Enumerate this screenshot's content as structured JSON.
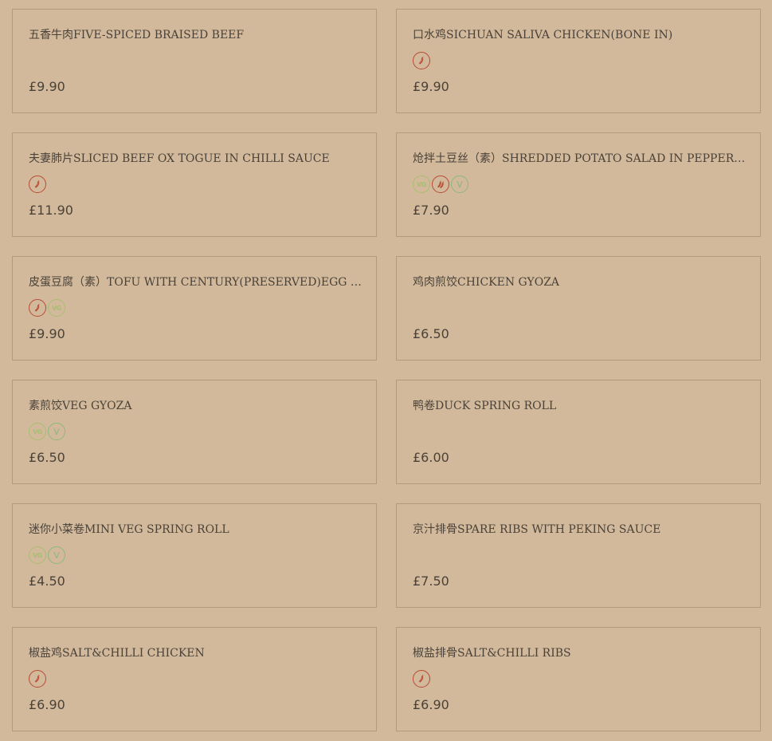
{
  "colors": {
    "background": "#d2b99b",
    "border": "#b39a7e",
    "text": "#4a4239",
    "chilli": "#b84a33",
    "vegan": "#a8be70",
    "vegetarian": "#8cb87a"
  },
  "badge_labels": {
    "chilli": "",
    "vg": "VG",
    "v": "V"
  },
  "items": [
    {
      "name": "五香牛肉FIVE-SPICED BRAISED BEEF",
      "price": "£9.90",
      "badges": []
    },
    {
      "name": "口水鸡SICHUAN SALIVA CHICKEN(BONE IN)",
      "price": "£9.90",
      "badges": [
        "chilli-icon"
      ]
    },
    {
      "name": "夫妻肺片SLICED BEEF OX TOGUE IN CHILLI SAUCE",
      "price": "£11.90",
      "badges": [
        "chilli-icon"
      ]
    },
    {
      "name": "炝拌土豆丝（素）SHREDDED POTATO SALAD IN PEPPERCOR...",
      "price": "£7.90",
      "badges": [
        "vegan-icon",
        "double-chilli-icon",
        "vegetarian-icon"
      ]
    },
    {
      "name": "皮蛋豆腐（素）TOFU WITH CENTURY(PRESERVED)EGG SALAD",
      "price": "£9.90",
      "badges": [
        "chilli-icon",
        "vegan-icon"
      ]
    },
    {
      "name": "鸡肉煎饺CHICKEN GYOZA",
      "price": "£6.50",
      "badges": []
    },
    {
      "name": "素煎饺VEG GYOZA",
      "price": "£6.50",
      "badges": [
        "vegan-icon",
        "vegetarian-icon"
      ]
    },
    {
      "name": "鸭卷DUCK SPRING ROLL",
      "price": "£6.00",
      "badges": []
    },
    {
      "name": "迷你小菜卷MINI VEG SPRING ROLL",
      "price": "£4.50",
      "badges": [
        "vegan-icon",
        "vegetarian-icon"
      ]
    },
    {
      "name": "京汁排骨SPARE RIBS WITH PEKING SAUCE",
      "price": "£7.50",
      "badges": []
    },
    {
      "name": "椒盐鸡SALT&CHILLI CHICKEN",
      "price": "£6.90",
      "badges": [
        "chilli-icon"
      ]
    },
    {
      "name": "椒盐排骨SALT&CHILLI RIBS",
      "price": "£6.90",
      "badges": [
        "chilli-icon"
      ]
    }
  ]
}
